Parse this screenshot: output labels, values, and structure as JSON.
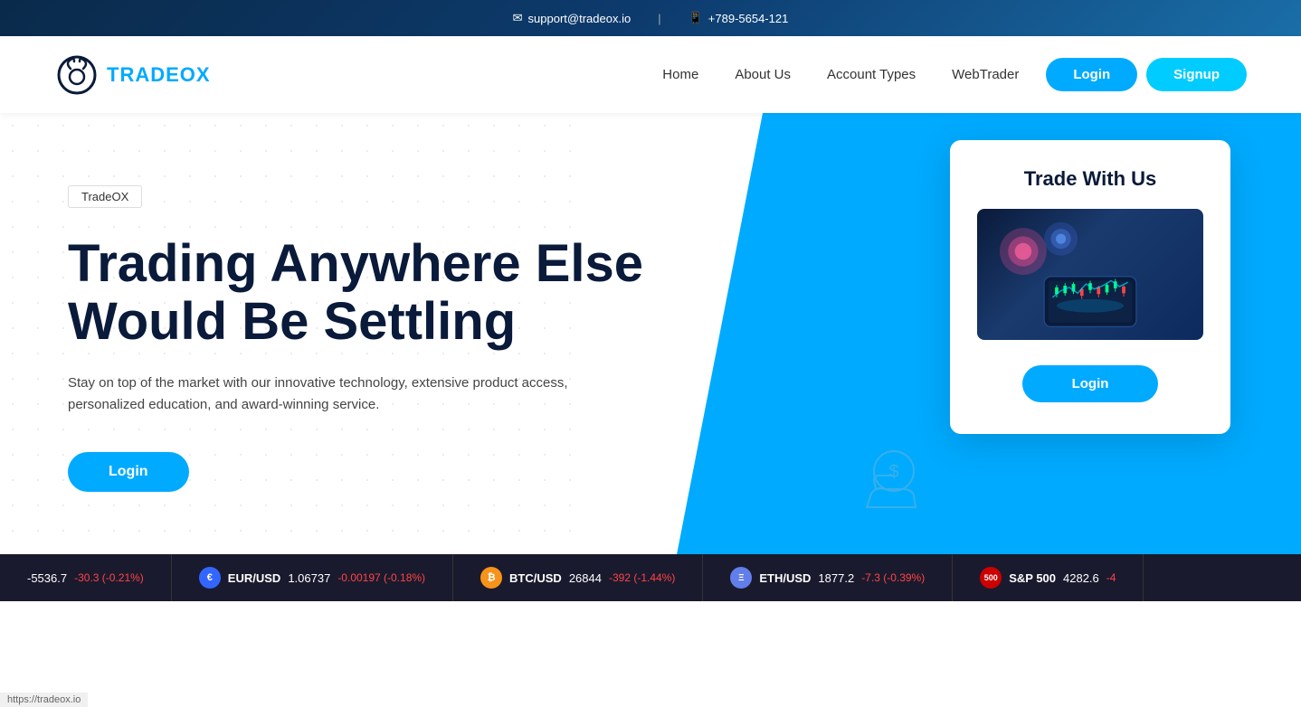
{
  "topbar": {
    "email_icon": "✉",
    "email": "support@tradeox.io",
    "phone_icon": "📱",
    "phone": "+789-5654-121",
    "separator": "|"
  },
  "navbar": {
    "logo_text_1": "TRADE",
    "logo_text_2": "OX",
    "links": [
      {
        "label": "Home",
        "id": "home"
      },
      {
        "label": "About Us",
        "id": "about"
      },
      {
        "label": "Account Types",
        "id": "account-types"
      },
      {
        "label": "WebTrader",
        "id": "webtrader"
      }
    ],
    "login_label": "Login",
    "signup_label": "Signup"
  },
  "hero": {
    "breadcrumb": "TradeOX",
    "title_line1": "Trading Anywhere Else",
    "title_line2": "Would Be Settling",
    "subtitle": "Stay on top of the market with our innovative technology, extensive product access, personalized education, and award-winning service.",
    "login_btn": "Login"
  },
  "trade_card": {
    "title": "Trade With Us",
    "login_btn": "Login"
  },
  "ticker": {
    "items": [
      {
        "symbol": "EUR/USD",
        "price": "1.06737",
        "change": "-0.00197",
        "change_pct": "-0.18%",
        "negative": true,
        "color": "#3366ff",
        "icon": "€",
        "prefix_value": ""
      },
      {
        "symbol": "BTC/USD",
        "price": "26844",
        "change": "-392",
        "change_pct": "-1.44%",
        "negative": true,
        "color": "#f7931a",
        "icon": "₿",
        "prefix_value": ""
      },
      {
        "symbol": "ETH/USD",
        "price": "1877.2",
        "change": "-7.3",
        "change_pct": "-0.39%",
        "negative": true,
        "color": "#627eea",
        "icon": "Ξ",
        "prefix_value": ""
      },
      {
        "symbol": "S&P 500",
        "price": "4282.6",
        "change": "-4",
        "change_pct": "",
        "negative": true,
        "color": "#cc0000",
        "icon": "S",
        "prefix_value": "500"
      }
    ],
    "left_partial": "-5536.7",
    "left_partial_change": "-30.3 (-0.21%)"
  },
  "status_bar": {
    "url": "https://tradeox.io"
  }
}
